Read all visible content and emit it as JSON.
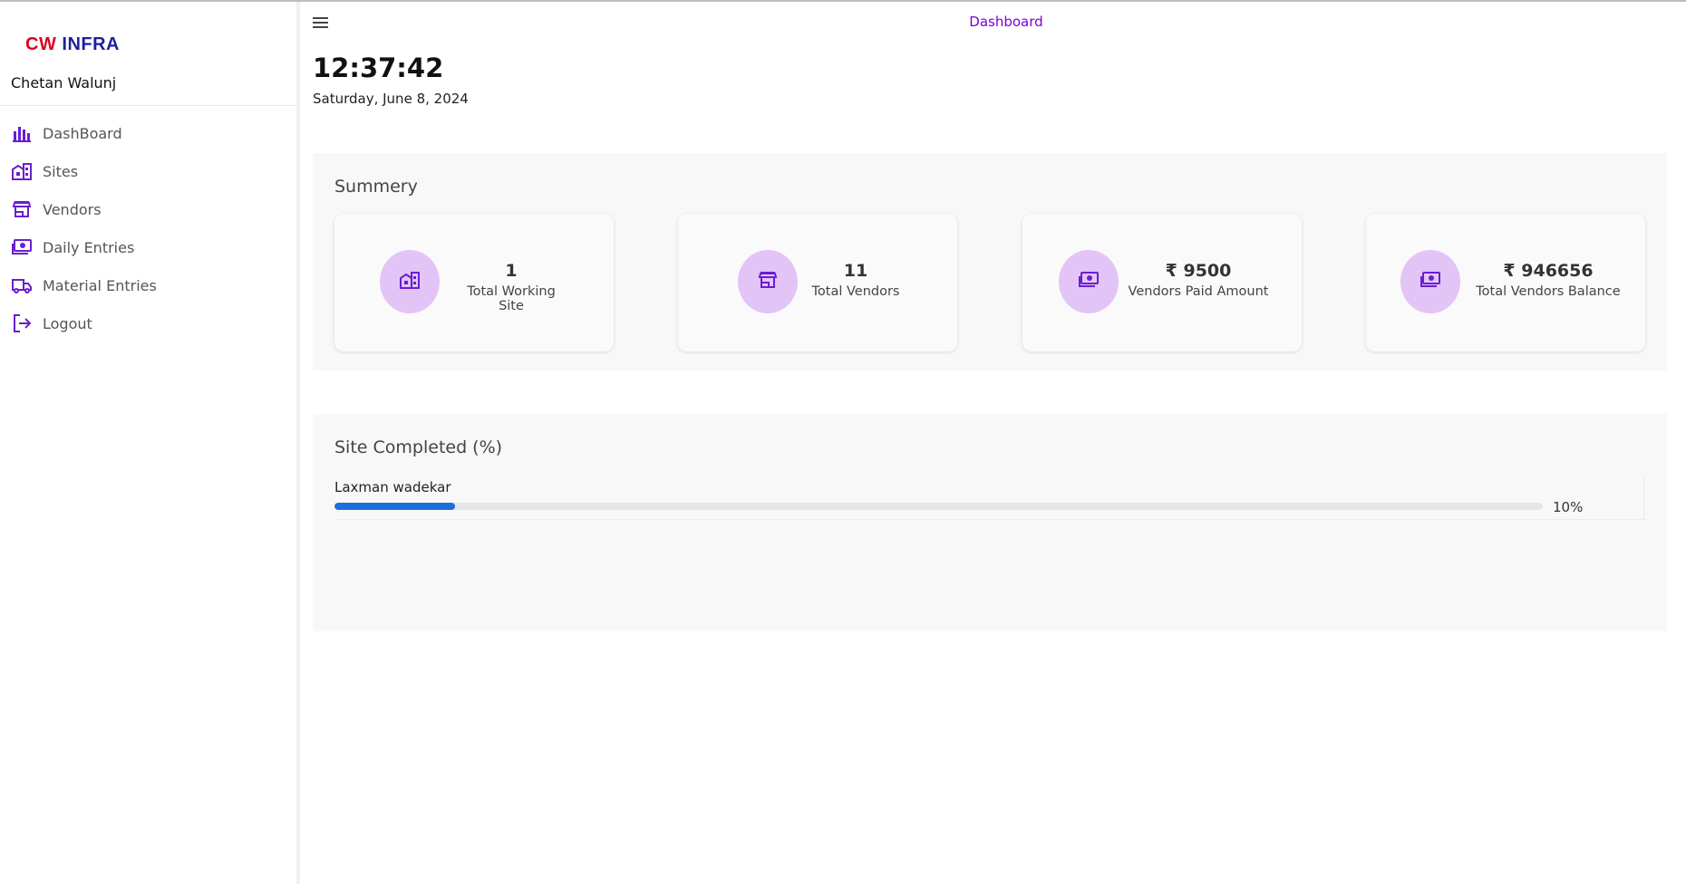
{
  "brand": {
    "part1": "CW",
    "part2": "INFRA"
  },
  "user": {
    "name": "Chetan Walunj"
  },
  "nav": [
    {
      "label": "DashBoard",
      "icon": "bar-chart-icon"
    },
    {
      "label": "Sites",
      "icon": "building-icon"
    },
    {
      "label": "Vendors",
      "icon": "store-icon"
    },
    {
      "label": "Daily Entries",
      "icon": "money-icon"
    },
    {
      "label": "Material Entries",
      "icon": "truck-icon"
    },
    {
      "label": "Logout",
      "icon": "logout-icon"
    }
  ],
  "header": {
    "title": "Dashboard"
  },
  "clock": {
    "time": "12:37:42",
    "date": "Saturday, June 8, 2024"
  },
  "summary": {
    "title": "Summery",
    "cards": [
      {
        "value": "1",
        "label": "Total Working Site",
        "icon": "building-icon"
      },
      {
        "value": "11",
        "label": "Total Vendors",
        "icon": "store-icon"
      },
      {
        "value": "₹ 9500",
        "label": "Vendors Paid Amount",
        "icon": "money-icon"
      },
      {
        "value": "₹ 946656",
        "label": "Total Vendors Balance",
        "icon": "money-icon"
      }
    ]
  },
  "sites_completed": {
    "title": "Site Completed (%)",
    "items": [
      {
        "name": "Laxman wadekar",
        "percent_text": "10%",
        "percent": 10
      }
    ]
  },
  "colors": {
    "accent": "#7a00d6",
    "icon_circle": "#e3c4f7",
    "progress": "#1d6fe0",
    "brand_red": "#e0001b",
    "brand_blue": "#1f1f9e"
  }
}
